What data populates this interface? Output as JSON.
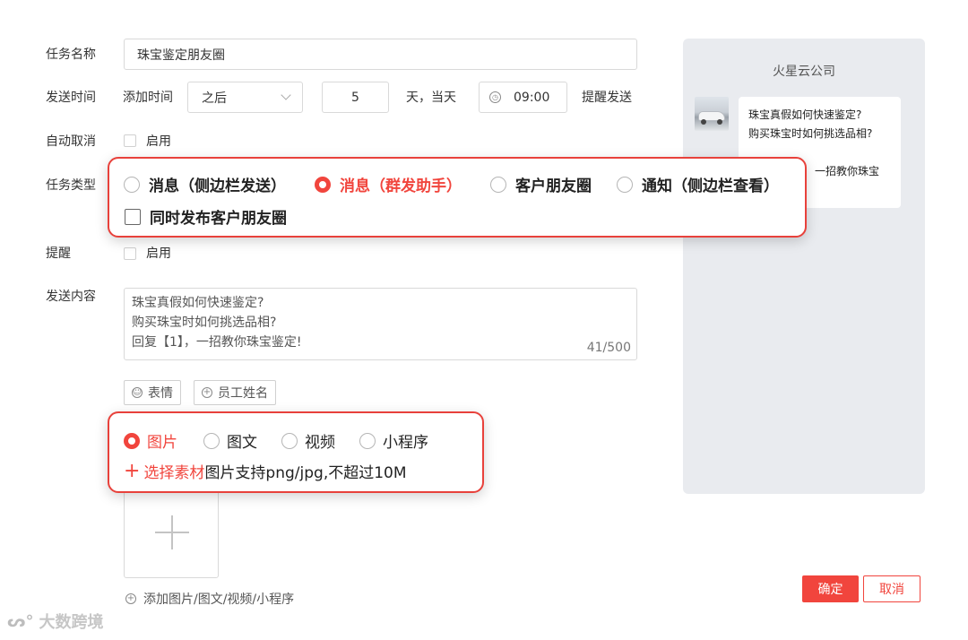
{
  "form": {
    "task_name_label": "任务名称",
    "task_name_value": "珠宝鉴定朋友圈",
    "send_time_label": "发送时间",
    "add_time_label": "添加时间",
    "after_select": "之后",
    "days_value": "5",
    "days_text": "天，当天",
    "time_value": "09:00",
    "remind_send_text": "提醒发送",
    "auto_cancel_label": "自动取消",
    "enable_text": "启用",
    "task_type_label": "任务类型",
    "remind_label": "提醒",
    "remind_enable_text": "启用",
    "send_content_label": "发送内容",
    "content_lines": [
      "珠宝真假如何快速鉴定?",
      "购买珠宝时如何挑选品相?",
      "回复【1】，一招教你珠宝鉴定!"
    ],
    "char_count": "41/500",
    "emoji_button": "表情",
    "employee_name_button": "员工姓名",
    "add_attachment_text": "添加图片/图文/视频/小程序"
  },
  "task_type_callout": {
    "options": [
      {
        "label": "消息（侧边栏发送）",
        "checked": false
      },
      {
        "label": "消息（群发助手）",
        "checked": true
      },
      {
        "label": "客户朋友圈",
        "checked": false
      },
      {
        "label": "通知（侧边栏查看）",
        "checked": false
      }
    ],
    "checkbox_label": "同时发布客户朋友圈"
  },
  "media_callout": {
    "options": [
      {
        "label": "图片",
        "checked": true
      },
      {
        "label": "图文",
        "checked": false
      },
      {
        "label": "视频",
        "checked": false
      },
      {
        "label": "小程序",
        "checked": false
      }
    ],
    "select_material": "选择素材",
    "hint": "图片支持png/jpg,不超过10M"
  },
  "preview": {
    "company": "火星云公司",
    "bubble_lines": [
      "珠宝真假如何快速鉴定?",
      "购买珠宝时如何挑选品相?"
    ],
    "bubble_tail": "一招教你珠宝"
  },
  "actions": {
    "confirm": "确定",
    "cancel": "取消"
  },
  "watermark": "大数跨境",
  "colors": {
    "accent": "#f1453d",
    "preview_bg": "#e9ebef"
  }
}
